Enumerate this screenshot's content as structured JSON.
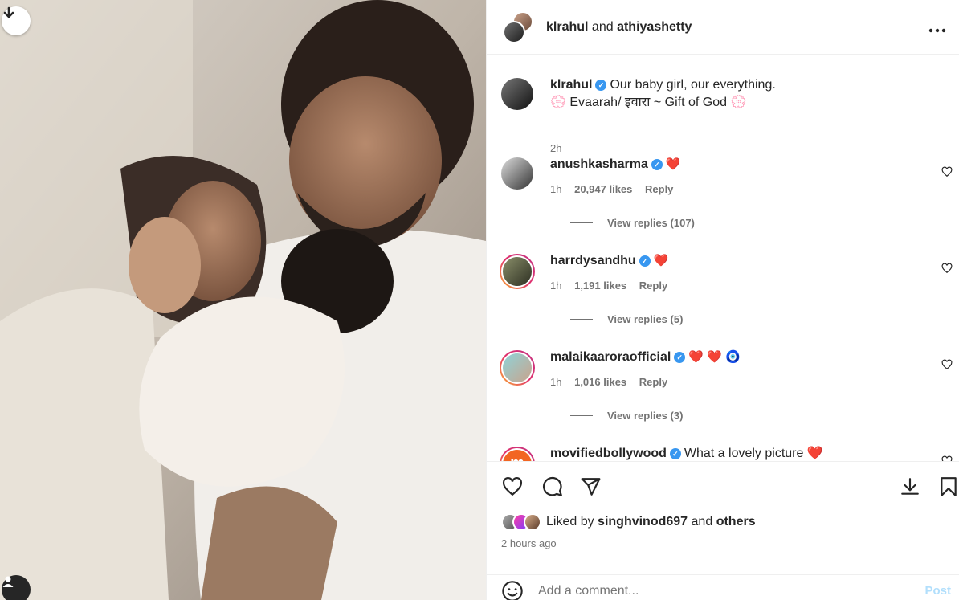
{
  "header": {
    "user1": "klrahul",
    "and": "and",
    "user2": "athiyashetty",
    "more_icon": "more-horizontal-icon"
  },
  "caption": {
    "username": "klrahul",
    "text": "Our baby girl, our everything.",
    "line2": "Evaarah/ इवारा ~ Gift of God",
    "emoji": "💮",
    "time": "2h"
  },
  "comments": [
    {
      "username": "anushkasharma",
      "text": "❤️",
      "time": "1h",
      "likes": "20,947 likes",
      "reply": "Reply",
      "view_replies": "View replies (107)"
    },
    {
      "username": "harrdysandhu",
      "text": "❤️",
      "time": "1h",
      "likes": "1,191 likes",
      "reply": "Reply",
      "view_replies": "View replies (5)"
    },
    {
      "username": "malaikaaroraofficial",
      "text": "❤️ ❤️ 🧿",
      "time": "1h",
      "likes": "1,016 likes",
      "reply": "Reply",
      "view_replies": "View replies (3)"
    },
    {
      "username": "movifiedbollywood",
      "text": "What a lovely picture ❤️",
      "avatar_letter": "m"
    }
  ],
  "actions": {
    "liked_by_prefix": "Liked by",
    "liked_by_user": "singhvinod697",
    "liked_by_and": "and",
    "liked_by_others": "others",
    "time_ago": "2 hours ago",
    "comment_placeholder": "Add a comment...",
    "post_label": "Post"
  },
  "colors": {
    "verified": "#3897f0",
    "heart": "#ed1c24",
    "secondary_text": "#737373",
    "post_disabled": "#b2dffc"
  }
}
